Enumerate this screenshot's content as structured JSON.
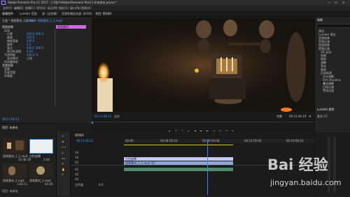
{
  "titlebar": {
    "title": "Adobe Premiere Pro CC 2017 - C:\\用户\\Adobe\\Premiere Pro\\11.0\\未命名.prproj *"
  },
  "menu": [
    "文件(F)",
    "编辑(E)",
    "剪辑(C)",
    "序列(S)",
    "标记(M)",
    "图形(G)",
    "窗口(W)",
    "帮助(H)"
  ],
  "workspace_tabs": [
    "效果控件",
    "Lumetri 范围",
    "源: (无剪辑)",
    "音频剪辑混合器: 序列01"
  ],
  "effect_controls": {
    "source_label": "主要 * 视频素材_1_1.mp4",
    "sequence_label": "序列01 * 视频素材_1_1.mp4",
    "rows": [
      "视频效果",
      "运动",
      "位置",
      "缩放",
      "缩放宽度",
      "旋转",
      "锚点",
      "防闪烁滤镜",
      "不透明度",
      "混合模式",
      "时间重映射",
      "音频效果",
      "音量",
      "声道音量",
      "声像器"
    ],
    "values": [
      "640.0  360.0",
      "100.0",
      "100.0",
      "0.0",
      "640.0  360.0",
      "0.00",
      "100.0 %",
      "正常"
    ],
    "clip_bar_label": "视频素材",
    "timecode": "00:11:06:12"
  },
  "program": {
    "label": "节目: 序列01",
    "timecode": "00:11:06:12",
    "fit": "适合",
    "quality": "完整",
    "duration": "00:15:46:19"
  },
  "right_panel": {
    "header": "效果",
    "items": [
      "预设",
      "Lumetri 预设",
      "音频效果",
      "音频过渡",
      "视频效果",
      "视频过渡",
      "3D 运动",
      "划像",
      "擦除",
      "溶解",
      "滑动",
      "缩放",
      "页面剥落",
      "交叉溶解",
      "Film Dissolve",
      "叠加溶解",
      "白场过渡",
      "黑场过渡"
    ],
    "footer": "Lumetri 颜色",
    "footer2": "基本 CC"
  },
  "project": {
    "header": "项目: 未命名",
    "clips": [
      {
        "name": "视频素材_1_1.mp4",
        "duration": "15:46:19"
      },
      {
        "name": "白色遮罩",
        "duration": "5:00"
      },
      {
        "name": "视频素材_2.mp4",
        "duration": "1:02:11"
      },
      {
        "name": "视频素材_3.mp4",
        "duration": "42:05"
      }
    ],
    "footer": "项目: 未命名"
  },
  "timeline": {
    "tab": "序列01",
    "timecode": "00:11:06:12",
    "ruler": [
      "00:00",
      "00:04:59:16",
      "00:09:59:08",
      "00:14:59:00",
      "00:19:58:16"
    ],
    "tracks": [
      "V3",
      "V2",
      "V1",
      "A1",
      "A2",
      "A3",
      "主声道"
    ],
    "clips": [
      {
        "label": "白色遮罩"
      },
      {
        "label": "视频素材_1_1.mp4 [V]"
      }
    ],
    "master_value": "0.0"
  },
  "watermark": {
    "text": "Bai 经验",
    "url": "jingyan.baidu.com"
  },
  "colors": {
    "accent": "#2d8ceb",
    "clip_video": "#8fa8d8",
    "clip_title": "#c9c9ff",
    "highlight": "#d36adf"
  }
}
